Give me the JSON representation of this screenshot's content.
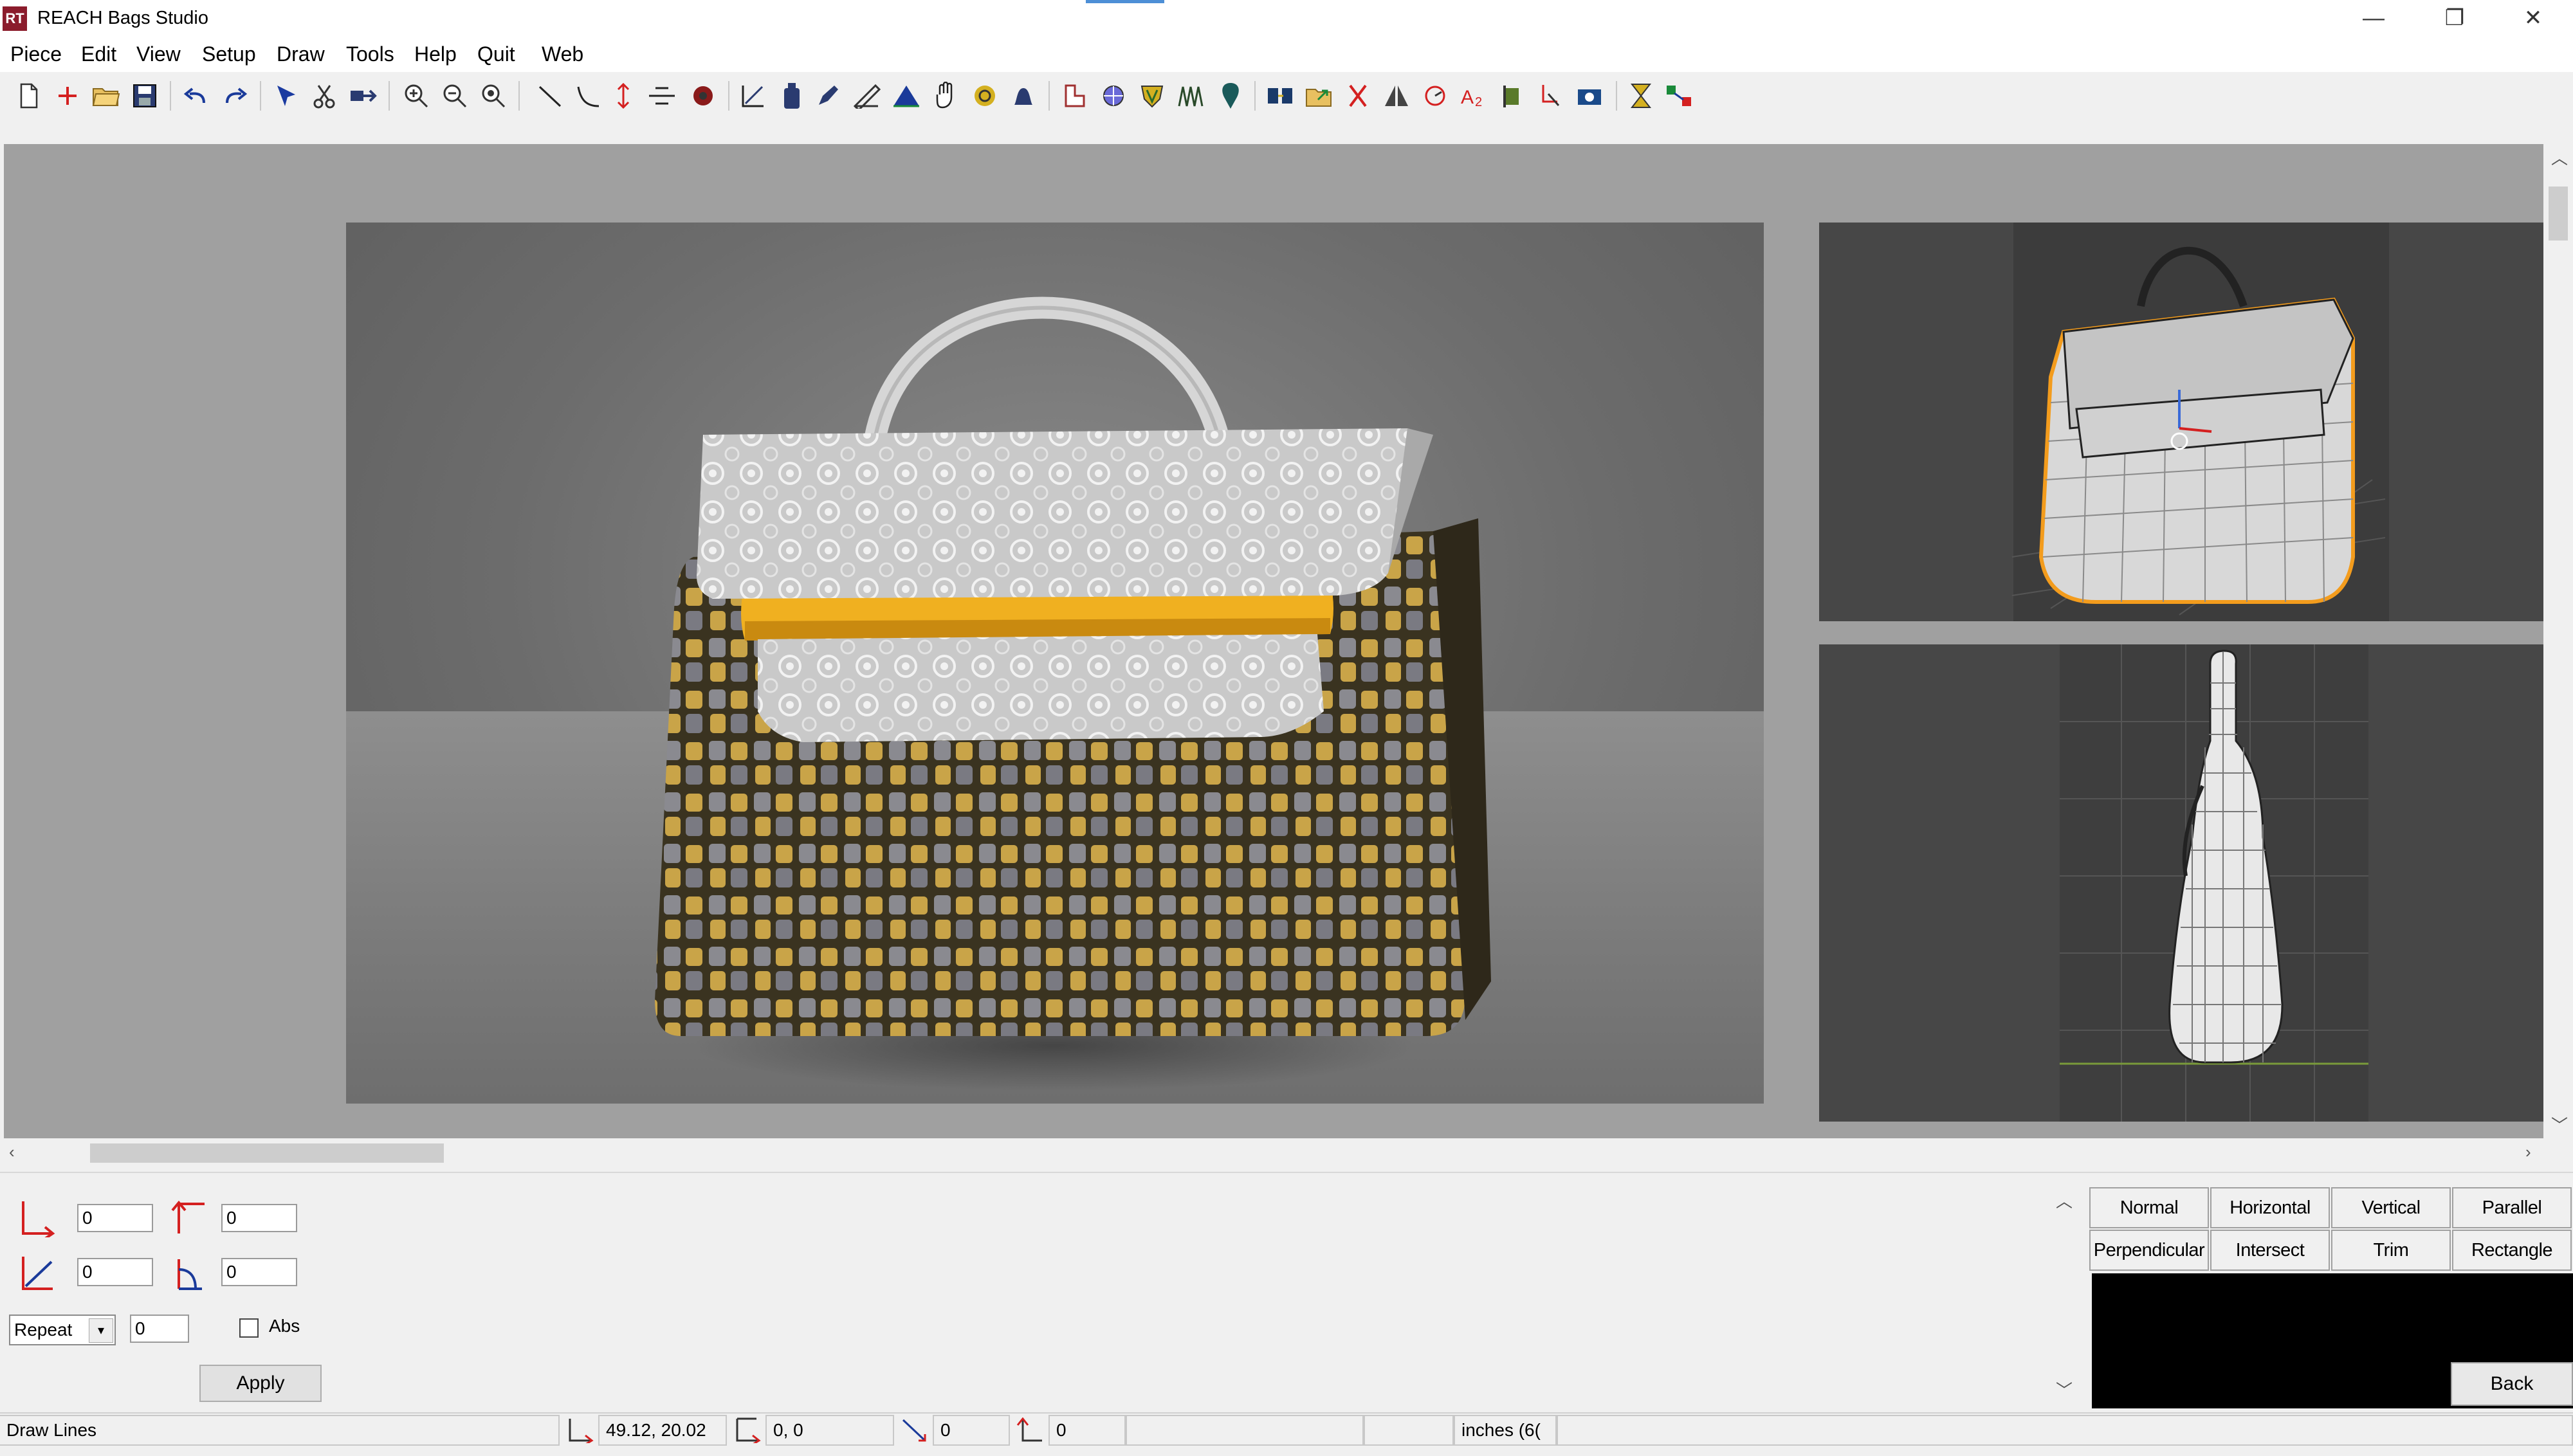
{
  "window": {
    "title": "REACH Bags Studio",
    "icon_text": "RT",
    "controls": {
      "minimize": "—",
      "maximize": "❐",
      "close": "✕"
    }
  },
  "menu": [
    "Piece",
    "Edit",
    "View",
    "Setup",
    "Draw",
    "Tools",
    "Help",
    "Quit",
    "Web"
  ],
  "toolbar_icons": [
    "new-file-icon",
    "add-icon",
    "open-folder-icon",
    "save-icon",
    "undo-icon",
    "redo-icon",
    "select-arrow-icon",
    "scissors-icon",
    "move-icon",
    "zoom-in-icon",
    "zoom-out-icon",
    "zoom-fit-icon",
    "draw-line-icon",
    "draw-curve-icon",
    "vertical-arrow-icon",
    "split-line-icon",
    "point-icon",
    "axis-icon",
    "bottle-icon",
    "pen-icon",
    "ruler-icon",
    "triangle-icon",
    "hand-icon",
    "spiral-icon",
    "bell-icon",
    "piece-icon",
    "globe-icon",
    "shield-icon",
    "grain-icon",
    "balloon-icon",
    "merge-icon",
    "export-icon",
    "cut-icon",
    "mirror-icon",
    "rotate-icon",
    "text-a2-icon",
    "flag-icon",
    "trim-icon",
    "camera-icon",
    "hourglass-icon",
    "link-icon"
  ],
  "inputs": {
    "x_value": "0",
    "y_value": "0",
    "angle_value": "0",
    "rotation_value": "0",
    "repeat_mode": "Repeat",
    "repeat_count": "0",
    "abs_label": "Abs",
    "apply_label": "Apply"
  },
  "mode_buttons": [
    [
      "Normal",
      "Horizontal",
      "Vertical",
      "Parallel"
    ],
    [
      "Perpendicular",
      "Intersect",
      "Trim",
      "Rectangle"
    ]
  ],
  "back_label": "Back",
  "status": {
    "mode": "Draw Lines",
    "coords": "49.12,  20.02",
    "offset": "0, 0",
    "length": "0",
    "angle": "0",
    "units": "inches (6("
  },
  "colors": {
    "accent": "#4d8fd6",
    "app_icon": "#8b1c2c",
    "bag_lace": "#d8d8d8",
    "bag_strap": "#f0b020",
    "bag_body": "#6b5830",
    "mesh_highlight": "#f39c1d"
  }
}
